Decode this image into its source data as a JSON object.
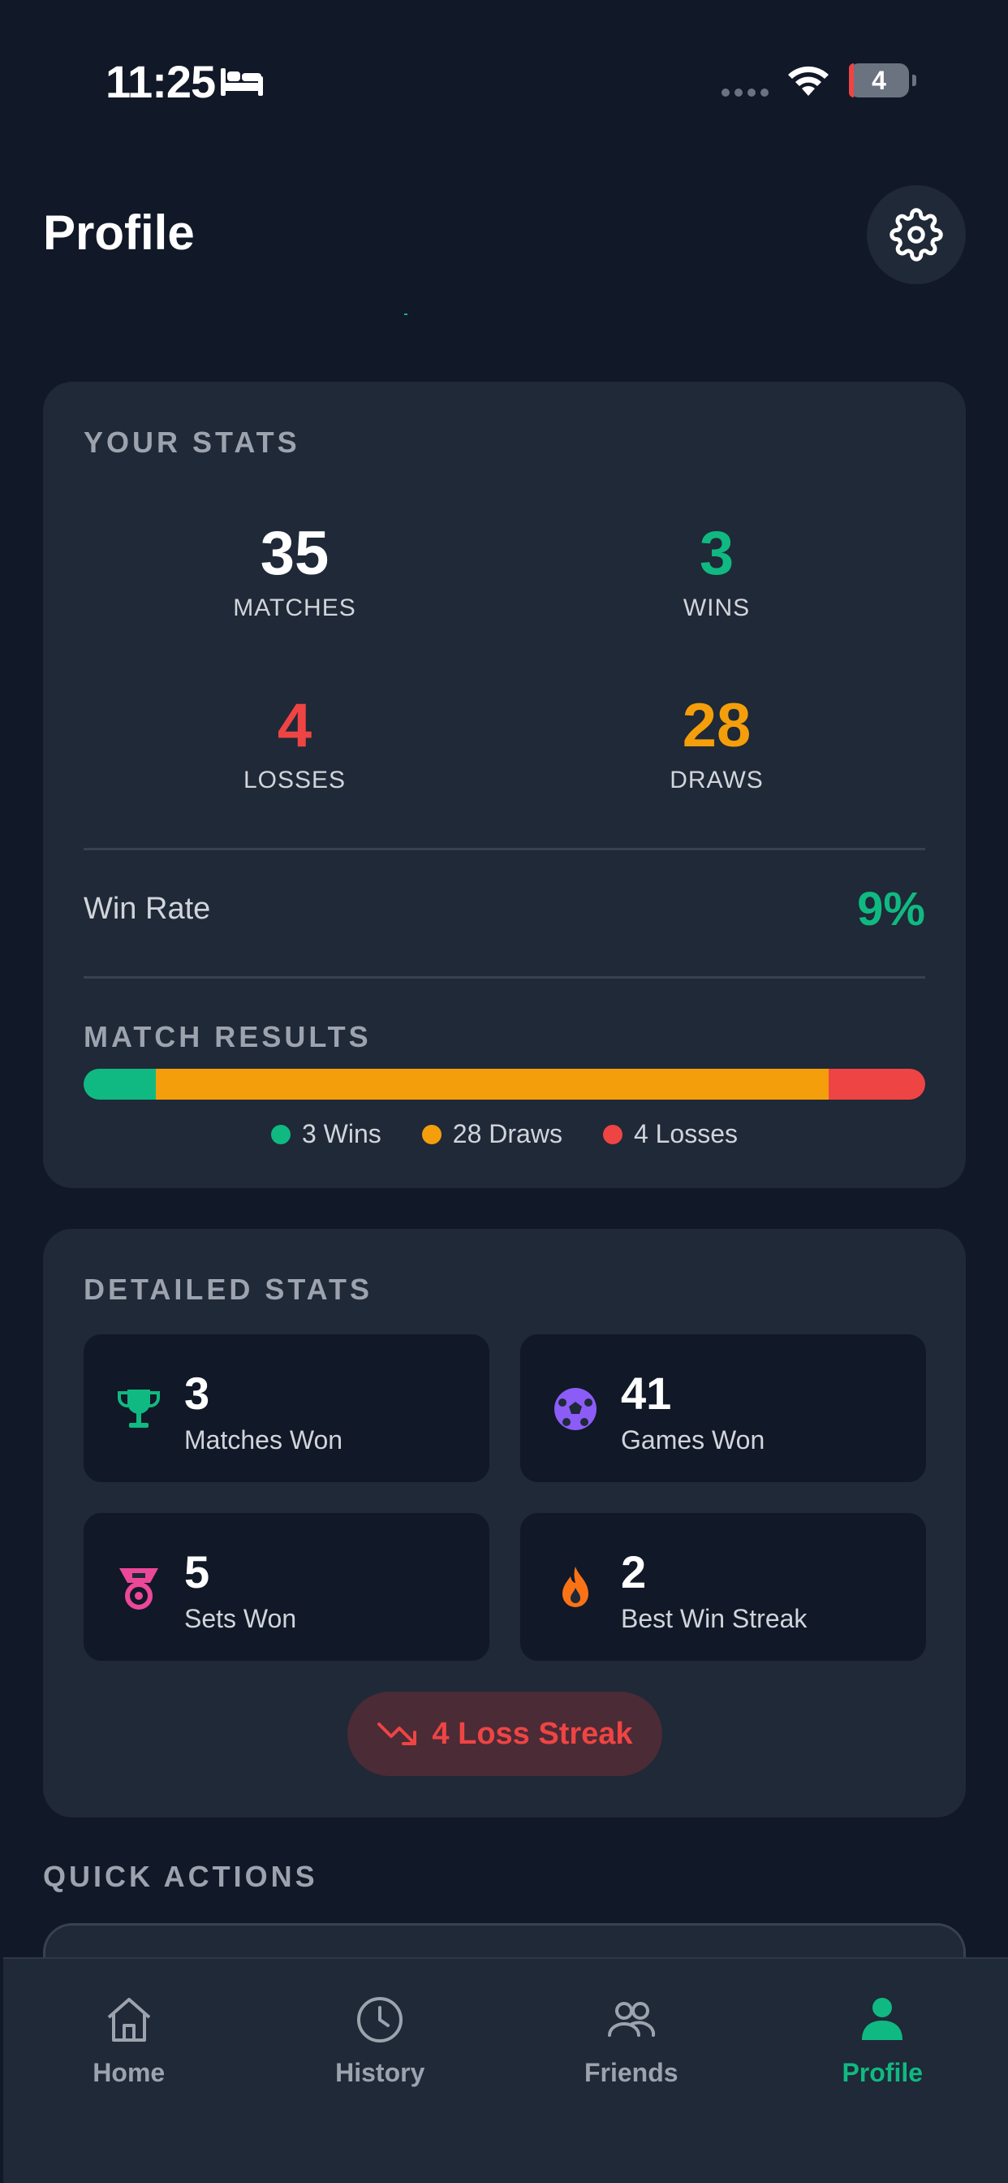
{
  "status_bar": {
    "time": "11:25",
    "battery": "4"
  },
  "header": {
    "title": "Profile"
  },
  "your_stats": {
    "label": "YOUR STATS",
    "matches": {
      "value": "35",
      "label": "MATCHES",
      "color": "#ffffff"
    },
    "wins": {
      "value": "3",
      "label": "WINS",
      "color": "#10b981"
    },
    "losses": {
      "value": "4",
      "label": "LOSSES",
      "color": "#ef4444"
    },
    "draws": {
      "value": "28",
      "label": "DRAWS",
      "color": "#f59e0b"
    },
    "win_rate_label": "Win Rate",
    "win_rate_value": "9%",
    "match_results_label": "MATCH RESULTS",
    "results_bar": {
      "wins": 3,
      "draws": 28,
      "losses": 4
    },
    "legend": {
      "wins": "3 Wins",
      "draws": "28 Draws",
      "losses": "4 Losses"
    }
  },
  "detailed_stats": {
    "label": "DETAILED STATS",
    "tiles": [
      {
        "value": "3",
        "label": "Matches Won",
        "icon": "trophy-icon",
        "color": "#10b981"
      },
      {
        "value": "41",
        "label": "Games Won",
        "icon": "soccer-ball-icon",
        "color": "#8b5cf6"
      },
      {
        "value": "5",
        "label": "Sets Won",
        "icon": "medal-icon",
        "color": "#ec4899"
      },
      {
        "value": "2",
        "label": "Best Win Streak",
        "icon": "flame-icon",
        "color": "#f97316"
      }
    ],
    "streak": "4 Loss Streak"
  },
  "quick_actions": {
    "label": "QUICK ACTIONS"
  },
  "tab_bar": {
    "tabs": [
      {
        "label": "Home",
        "icon": "home-icon"
      },
      {
        "label": "History",
        "icon": "clock-icon"
      },
      {
        "label": "Friends",
        "icon": "users-icon"
      },
      {
        "label": "Profile",
        "icon": "user-icon",
        "active": true
      }
    ]
  },
  "colors": {
    "accent": "#10b981",
    "win": "#10b981",
    "draw": "#f59e0b",
    "loss": "#ef4444",
    "card": "#1f2937",
    "background": "#111827"
  }
}
